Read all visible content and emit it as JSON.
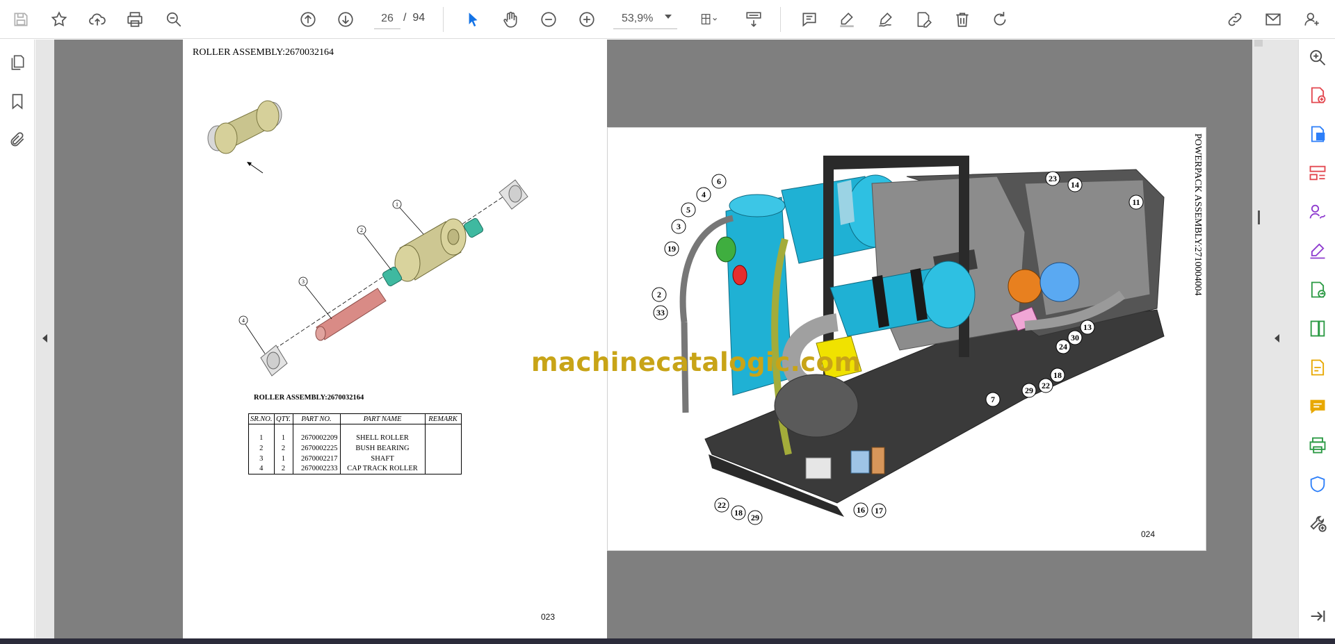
{
  "toolbar": {
    "icons": [
      "save-icon",
      "star-icon",
      "cloud-upload-icon",
      "print-icon",
      "zoom-search-icon",
      "page-up-icon",
      "page-down-icon",
      "select-cursor-icon",
      "hand-icon",
      "zoom-out-icon",
      "zoom-in-icon",
      "page-fit-icon",
      "scroll-mode-icon",
      "comment-icon",
      "highlight-icon",
      "draw-icon",
      "edit-text-icon",
      "delete-icon",
      "rotate-icon",
      "share-link-icon",
      "email-icon",
      "account-icon"
    ],
    "current_page": "26",
    "page_separator": "/",
    "total_pages": "94",
    "zoom": "53,9%",
    "accent_color": "#1473e6"
  },
  "left_nav": {
    "icons": [
      "page-thumbnails-icon",
      "bookmark-icon",
      "attachment-icon"
    ]
  },
  "page_a": {
    "title": "ROLLER ASSEMBLY:2670032164",
    "subtitle": "ROLLER ASSEMBLY:2670032164",
    "page_number": "023",
    "callouts": [
      "1",
      "2",
      "3",
      "4"
    ],
    "table": {
      "headers": [
        "SR.NO.",
        "QTY.",
        "PART NO.",
        "PART NAME",
        "REMARK"
      ],
      "rows": [
        [
          "1",
          "1",
          "2670002209",
          "SHELL ROLLER",
          ""
        ],
        [
          "2",
          "2",
          "2670002225",
          "BUSH BEARING",
          ""
        ],
        [
          "3",
          "1",
          "2670002217",
          "SHAFT",
          ""
        ],
        [
          "4",
          "2",
          "2670002233",
          "CAP TRACK ROLLER",
          ""
        ]
      ]
    }
  },
  "page_b": {
    "title": "POWERPACK ASSEMBLY:2710004004",
    "page_number": "024",
    "callouts": [
      "6",
      "4",
      "5",
      "3",
      "19",
      "2",
      "33",
      "23",
      "14",
      "11",
      "13",
      "30",
      "24",
      "18",
      "22",
      "29",
      "7",
      "22",
      "18",
      "29",
      "16",
      "17"
    ]
  },
  "watermark": "machinecatalogic.com",
  "right_tools": {
    "icons": [
      "zoom-icon",
      "create-pdf-icon",
      "export-pdf-icon",
      "organize-pages-icon",
      "request-signature-icon",
      "fill-sign-icon",
      "send-for-review-icon",
      "compress-icon",
      "edit-pdf-icon",
      "comment-tool-icon",
      "print-production-icon",
      "protect-icon",
      "more-tools-icon",
      "expand-panel-icon"
    ],
    "colors": {
      "red": "#e34850",
      "blue": "#2d7ff9",
      "purple": "#8f3ccf",
      "yellow": "#e8a800",
      "green": "#2b9a44",
      "gray": "#4b4b4b"
    }
  }
}
